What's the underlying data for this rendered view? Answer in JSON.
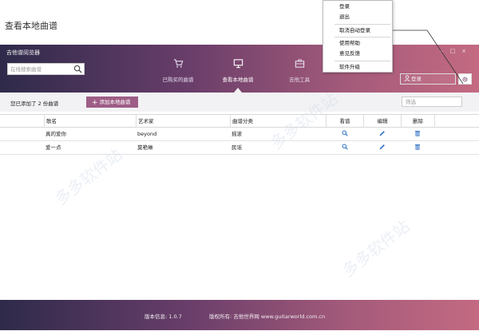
{
  "page": {
    "title": "查看本地曲谱"
  },
  "app": {
    "name": "吉他谱阅览器"
  },
  "search": {
    "placeholder": "在线搜索曲谱"
  },
  "nav": [
    {
      "label": "已购买的曲谱",
      "icon": "cart-icon",
      "active": false
    },
    {
      "label": "查看本地曲谱",
      "icon": "monitor-icon",
      "active": true
    },
    {
      "label": "吉他工具",
      "icon": "toolbox-icon",
      "active": false
    }
  ],
  "window_controls": {
    "minimize": "–",
    "maximize": "□",
    "close": "×"
  },
  "login": {
    "label": "登录"
  },
  "toolbar": {
    "count_text": "您已添加了 2 份曲谱",
    "add_button": "添加本地曲谱",
    "filter_placeholder": "筛选"
  },
  "table": {
    "columns": [
      "歌名",
      "艺术家",
      "曲谱分类",
      "看谱",
      "编辑",
      "删除"
    ],
    "rows": [
      {
        "song": "真的爱你",
        "artist": "beyond",
        "category": "摇滚"
      },
      {
        "song": "爱一点",
        "artist": "莫艳琳",
        "category": "民谣"
      }
    ]
  },
  "footer": {
    "version": "版本信息: 1.0.7",
    "copyright": "版权所有: 吉他世界网 www.guitarworld.com.cn"
  },
  "context_menu": {
    "items": [
      "登录",
      "退出",
      "取消自动登录",
      "使用帮助",
      "意见反馈",
      "软件升级"
    ]
  },
  "watermark": {
    "text": "多多软件站"
  },
  "colors": {
    "header_start": "#2e2a4a",
    "header_end": "#c46a82",
    "accent": "#9e5d86",
    "icon_blue": "#2f6fc4"
  }
}
